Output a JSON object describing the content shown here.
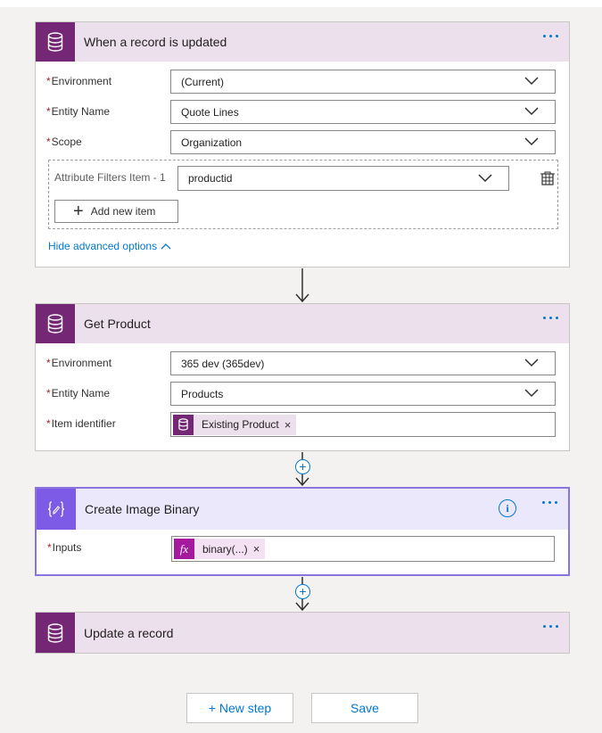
{
  "colors": {
    "cds_accent": "#742774",
    "compose_accent": "#7d5be6",
    "link": "#0078d4",
    "required": "#a4262c"
  },
  "trigger": {
    "title": "When a record is updated",
    "icon": "database-icon",
    "fields": [
      {
        "required_mark": "*",
        "label": "Environment",
        "value": "(Current)"
      },
      {
        "required_mark": "*",
        "label": "Entity Name",
        "value": "Quote Lines"
      },
      {
        "required_mark": "*",
        "label": "Scope",
        "value": "Organization"
      }
    ],
    "attribute_filters": {
      "label": "Attribute Filters Item - 1",
      "value": "productid",
      "add_label": "Add new item"
    },
    "advanced_link": "Hide advanced options"
  },
  "get_product": {
    "title": "Get Product",
    "icon": "database-icon",
    "fields": [
      {
        "required_mark": "*",
        "label": "Environment",
        "value": "365 dev (365dev)"
      },
      {
        "required_mark": "*",
        "label": "Entity Name",
        "value": "Products"
      },
      {
        "required_mark": "*",
        "label": "Item identifier",
        "token": "Existing Product",
        "token_remove": "×"
      }
    ]
  },
  "compose": {
    "title": "Create Image Binary",
    "icon": "compose-braces-icon",
    "info_label": "i",
    "fields": [
      {
        "required_mark": "*",
        "label": "Inputs",
        "token_icon_label": "fx",
        "token": "binary(...)",
        "token_remove": "×"
      }
    ]
  },
  "update": {
    "title": "Update a record",
    "icon": "database-icon"
  },
  "connector_plus": "+",
  "buttons": {
    "new_step": "+ New step",
    "save": "Save"
  }
}
